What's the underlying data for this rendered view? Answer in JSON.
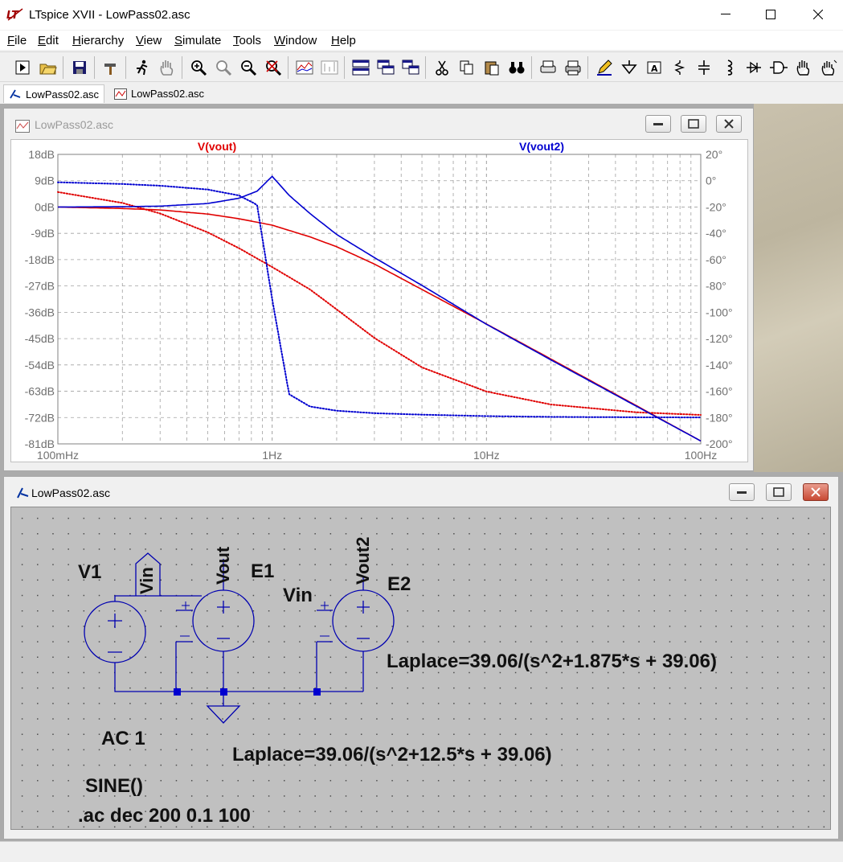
{
  "window": {
    "title": "LTspice XVII - LowPass02.asc"
  },
  "menu": [
    "File",
    "Edit",
    "Hierarchy",
    "View",
    "Simulate",
    "Tools",
    "Window",
    "Help"
  ],
  "tabs": [
    {
      "label": "LowPass02.asc",
      "kind": "schematic",
      "active": true
    },
    {
      "label": "LowPass02.asc",
      "kind": "waveform",
      "active": false
    }
  ],
  "waveform_window": {
    "title": "LowPass02.asc"
  },
  "schematic_window": {
    "title": "LowPass02.asc"
  },
  "chart_data": {
    "type": "line",
    "title": "",
    "x_scale": "log",
    "xlim": [
      0.1,
      100
    ],
    "x_ticks": [
      "100mHz",
      "1Hz",
      "10Hz",
      "100Hz"
    ],
    "y_left_label": "dB",
    "y_left_ticks": [
      "18dB",
      "9dB",
      "0dB",
      "-9dB",
      "-18dB",
      "-27dB",
      "-36dB",
      "-45dB",
      "-54dB",
      "-63dB",
      "-72dB",
      "-81dB"
    ],
    "ylim_left": [
      -81,
      18
    ],
    "y_right_ticks": [
      "20°",
      "0°",
      "-20°",
      "-40°",
      "-60°",
      "-80°",
      "-100°",
      "-120°",
      "-140°",
      "-160°",
      "-180°",
      "-200°"
    ],
    "ylim_right": [
      -200,
      20
    ],
    "grid": true,
    "legend": [
      "V(vout)",
      "V(vout2)"
    ],
    "series": [
      {
        "name": "V(vout)",
        "trace": "magnitude",
        "color": "#e00000",
        "style": "solid",
        "x": [
          0.1,
          0.2,
          0.3,
          0.5,
          0.7,
          1,
          1.5,
          2,
          3,
          5,
          10,
          20,
          50,
          100
        ],
        "y": [
          0,
          -0.5,
          -1.0,
          -2.4,
          -4.0,
          -6.2,
          -10.2,
          -13.6,
          -19.5,
          -28.2,
          -40.0,
          -52.0,
          -67.9,
          -80.0
        ]
      },
      {
        "name": "V(vout)",
        "trace": "phase",
        "color": "#e00000",
        "style": "dotted",
        "x": [
          0.1,
          0.2,
          0.3,
          0.5,
          0.7,
          1,
          1.5,
          2,
          3,
          5,
          10,
          20,
          50,
          100
        ],
        "y": [
          -8.6,
          -16.9,
          -24.9,
          -39.2,
          -51.3,
          -65.6,
          -82.6,
          -97.8,
          -119.5,
          -141.9,
          -160.2,
          -170.1,
          -176.0,
          -178.0
        ]
      },
      {
        "name": "V(vout2)",
        "trace": "magnitude",
        "color": "#0000d0",
        "style": "solid",
        "x": [
          0.1,
          0.2,
          0.3,
          0.5,
          0.7,
          0.85,
          1,
          1.2,
          1.5,
          2,
          3,
          5,
          10,
          20,
          50,
          100
        ],
        "y": [
          0.0,
          0.1,
          0.3,
          1.2,
          3.0,
          5.4,
          10.5,
          4.0,
          -2.2,
          -9.4,
          -17.3,
          -26.8,
          -40.1,
          -52.3,
          -68.1,
          -80.0
        ]
      },
      {
        "name": "V(vout2)",
        "trace": "phase",
        "color": "#0000d0",
        "style": "dotted",
        "x": [
          0.1,
          0.2,
          0.3,
          0.5,
          0.7,
          0.85,
          1,
          1.2,
          1.5,
          2,
          3,
          5,
          10,
          20,
          50,
          100
        ],
        "y": [
          -1.2,
          -2.5,
          -3.8,
          -6.7,
          -11.2,
          -18.3,
          -90.0,
          -162.3,
          -171.6,
          -174.8,
          -176.7,
          -177.8,
          -178.9,
          -179.5,
          -179.8,
          -179.9
        ]
      }
    ]
  },
  "schematic": {
    "labels": {
      "v1": "V1",
      "vin_flag": "Vin",
      "vout_flag": "Vout",
      "e1": "E1",
      "vin_label": "Vin",
      "vout2_flag": "Vout2",
      "e2": "E2",
      "laplace1": "Laplace=39.06/(s^2+1.875*s + 39.06)",
      "laplace2": "Laplace=39.06/(s^2+12.5*s + 39.06)",
      "ac": "AC 1",
      "sine": "SINE()",
      "directive": ".ac dec 200 0.1 100"
    },
    "wire_color": "#0000b0"
  }
}
